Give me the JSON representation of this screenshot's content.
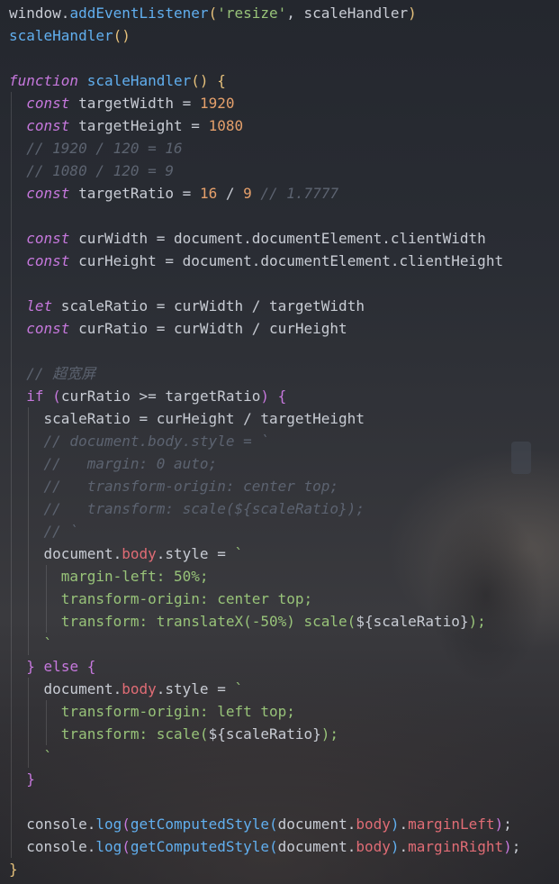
{
  "editor": {
    "language": "javascript",
    "colors": {
      "background": "#2a2d35",
      "plain": "#c8ccd4",
      "function": "#61afef",
      "string": "#98c379",
      "keyword": "#c678dd",
      "number": "#e5a06b",
      "comment": "#5c6370",
      "property": "#e06c75",
      "bracket": "#e5c07b"
    },
    "lines": [
      {
        "indent": 0,
        "tokens": [
          [
            "plain",
            "window."
          ],
          [
            "fn",
            "addEventListener"
          ],
          [
            "paren",
            "("
          ],
          [
            "str",
            "'resize'"
          ],
          [
            "plain",
            ", scaleHandler"
          ],
          [
            "paren",
            ")"
          ]
        ]
      },
      {
        "indent": 0,
        "tokens": [
          [
            "fn",
            "scaleHandler"
          ],
          [
            "paren",
            "()"
          ]
        ]
      },
      {
        "indent": 0,
        "tokens": []
      },
      {
        "indent": 0,
        "tokens": [
          [
            "kwi",
            "function"
          ],
          [
            "plain",
            " "
          ],
          [
            "fn",
            "scaleHandler"
          ],
          [
            "paren",
            "()"
          ],
          [
            "plain",
            " "
          ],
          [
            "paren",
            "{"
          ]
        ]
      },
      {
        "indent": 1,
        "tokens": [
          [
            "kwi",
            "const"
          ],
          [
            "plain",
            " targetWidth = "
          ],
          [
            "num",
            "1920"
          ]
        ]
      },
      {
        "indent": 1,
        "tokens": [
          [
            "kwi",
            "const"
          ],
          [
            "plain",
            " targetHeight = "
          ],
          [
            "num",
            "1080"
          ]
        ]
      },
      {
        "indent": 1,
        "tokens": [
          [
            "cm",
            "// 1920 / 120 = 16"
          ]
        ]
      },
      {
        "indent": 1,
        "tokens": [
          [
            "cm",
            "// 1080 / 120 = 9"
          ]
        ]
      },
      {
        "indent": 1,
        "tokens": [
          [
            "kwi",
            "const"
          ],
          [
            "plain",
            " targetRatio = "
          ],
          [
            "num",
            "16"
          ],
          [
            "plain",
            " / "
          ],
          [
            "num",
            "9"
          ],
          [
            "plain",
            " "
          ],
          [
            "cm",
            "// 1.7777"
          ]
        ]
      },
      {
        "indent": 1,
        "tokens": []
      },
      {
        "indent": 1,
        "tokens": [
          [
            "kwi",
            "const"
          ],
          [
            "plain",
            " curWidth = document.documentElement.clientWidth"
          ]
        ]
      },
      {
        "indent": 1,
        "tokens": [
          [
            "kwi",
            "const"
          ],
          [
            "plain",
            " curHeight = document.documentElement.clientHeight"
          ]
        ]
      },
      {
        "indent": 1,
        "tokens": []
      },
      {
        "indent": 1,
        "tokens": [
          [
            "kwi",
            "let"
          ],
          [
            "plain",
            " scaleRatio = curWidth / targetWidth"
          ]
        ]
      },
      {
        "indent": 1,
        "tokens": [
          [
            "kwi",
            "const"
          ],
          [
            "plain",
            " curRatio = curWidth / curHeight"
          ]
        ]
      },
      {
        "indent": 1,
        "tokens": []
      },
      {
        "indent": 1,
        "tokens": [
          [
            "cm",
            "// 超宽屏"
          ]
        ]
      },
      {
        "indent": 1,
        "tokens": [
          [
            "kw",
            "if"
          ],
          [
            "plain",
            " "
          ],
          [
            "paren2",
            "("
          ],
          [
            "plain",
            "curRatio >= targetRatio"
          ],
          [
            "paren2",
            ")"
          ],
          [
            "plain",
            " "
          ],
          [
            "paren2",
            "{"
          ]
        ]
      },
      {
        "indent": 2,
        "tokens": [
          [
            "plain",
            "scaleRatio = curHeight / targetHeight"
          ]
        ]
      },
      {
        "indent": 2,
        "tokens": [
          [
            "cm",
            "// document.body.style = `"
          ]
        ]
      },
      {
        "indent": 2,
        "tokens": [
          [
            "cm",
            "//   margin: 0 auto;"
          ]
        ]
      },
      {
        "indent": 2,
        "tokens": [
          [
            "cm",
            "//   transform-origin: center top;"
          ]
        ]
      },
      {
        "indent": 2,
        "tokens": [
          [
            "cm",
            "//   transform: scale(${scaleRatio});"
          ]
        ]
      },
      {
        "indent": 2,
        "tokens": [
          [
            "cm",
            "// `"
          ]
        ]
      },
      {
        "indent": 2,
        "tokens": [
          [
            "plain",
            "document."
          ],
          [
            "prop",
            "body"
          ],
          [
            "plain",
            ".style = "
          ],
          [
            "tick",
            "`"
          ]
        ]
      },
      {
        "indent": 3,
        "tokens": [
          [
            "css",
            "margin-left: 50%;"
          ]
        ]
      },
      {
        "indent": 3,
        "tokens": [
          [
            "css",
            "transform-origin: center top;"
          ]
        ]
      },
      {
        "indent": 3,
        "tokens": [
          [
            "css",
            "transform: translateX(-50%) scale("
          ],
          [
            "plain",
            "${scaleRatio}"
          ],
          [
            "css",
            ");"
          ]
        ]
      },
      {
        "indent": 2,
        "tokens": [
          [
            "tick",
            "`"
          ]
        ]
      },
      {
        "indent": 1,
        "tokens": [
          [
            "paren2",
            "}"
          ],
          [
            "plain",
            " "
          ],
          [
            "kw",
            "else"
          ],
          [
            "plain",
            " "
          ],
          [
            "paren2",
            "{"
          ]
        ]
      },
      {
        "indent": 2,
        "tokens": [
          [
            "plain",
            "document."
          ],
          [
            "prop",
            "body"
          ],
          [
            "plain",
            ".style = "
          ],
          [
            "tick",
            "`"
          ]
        ]
      },
      {
        "indent": 3,
        "tokens": [
          [
            "css",
            "transform-origin: left top;"
          ]
        ]
      },
      {
        "indent": 3,
        "tokens": [
          [
            "css",
            "transform: scale("
          ],
          [
            "plain",
            "${scaleRatio}"
          ],
          [
            "css",
            ");"
          ]
        ]
      },
      {
        "indent": 2,
        "tokens": [
          [
            "tick",
            "`"
          ]
        ]
      },
      {
        "indent": 1,
        "tokens": [
          [
            "paren2",
            "}"
          ]
        ]
      },
      {
        "indent": 1,
        "tokens": []
      },
      {
        "indent": 1,
        "tokens": [
          [
            "plain",
            "console."
          ],
          [
            "fn",
            "log"
          ],
          [
            "paren2",
            "("
          ],
          [
            "fn",
            "getComputedStyle"
          ],
          [
            "paren3",
            "("
          ],
          [
            "plain",
            "document."
          ],
          [
            "prop",
            "body"
          ],
          [
            "paren3",
            ")"
          ],
          [
            "plain",
            "."
          ],
          [
            "prop",
            "marginLeft"
          ],
          [
            "paren2",
            ")"
          ],
          [
            "plain",
            ";"
          ]
        ]
      },
      {
        "indent": 1,
        "tokens": [
          [
            "plain",
            "console."
          ],
          [
            "fn",
            "log"
          ],
          [
            "paren2",
            "("
          ],
          [
            "fn",
            "getComputedStyle"
          ],
          [
            "paren3",
            "("
          ],
          [
            "plain",
            "document."
          ],
          [
            "prop",
            "body"
          ],
          [
            "paren3",
            ")"
          ],
          [
            "plain",
            "."
          ],
          [
            "prop",
            "marginRight"
          ],
          [
            "paren2",
            ")"
          ],
          [
            "plain",
            ";"
          ]
        ]
      },
      {
        "indent": 0,
        "tokens": [
          [
            "paren",
            "}"
          ]
        ]
      }
    ]
  }
}
